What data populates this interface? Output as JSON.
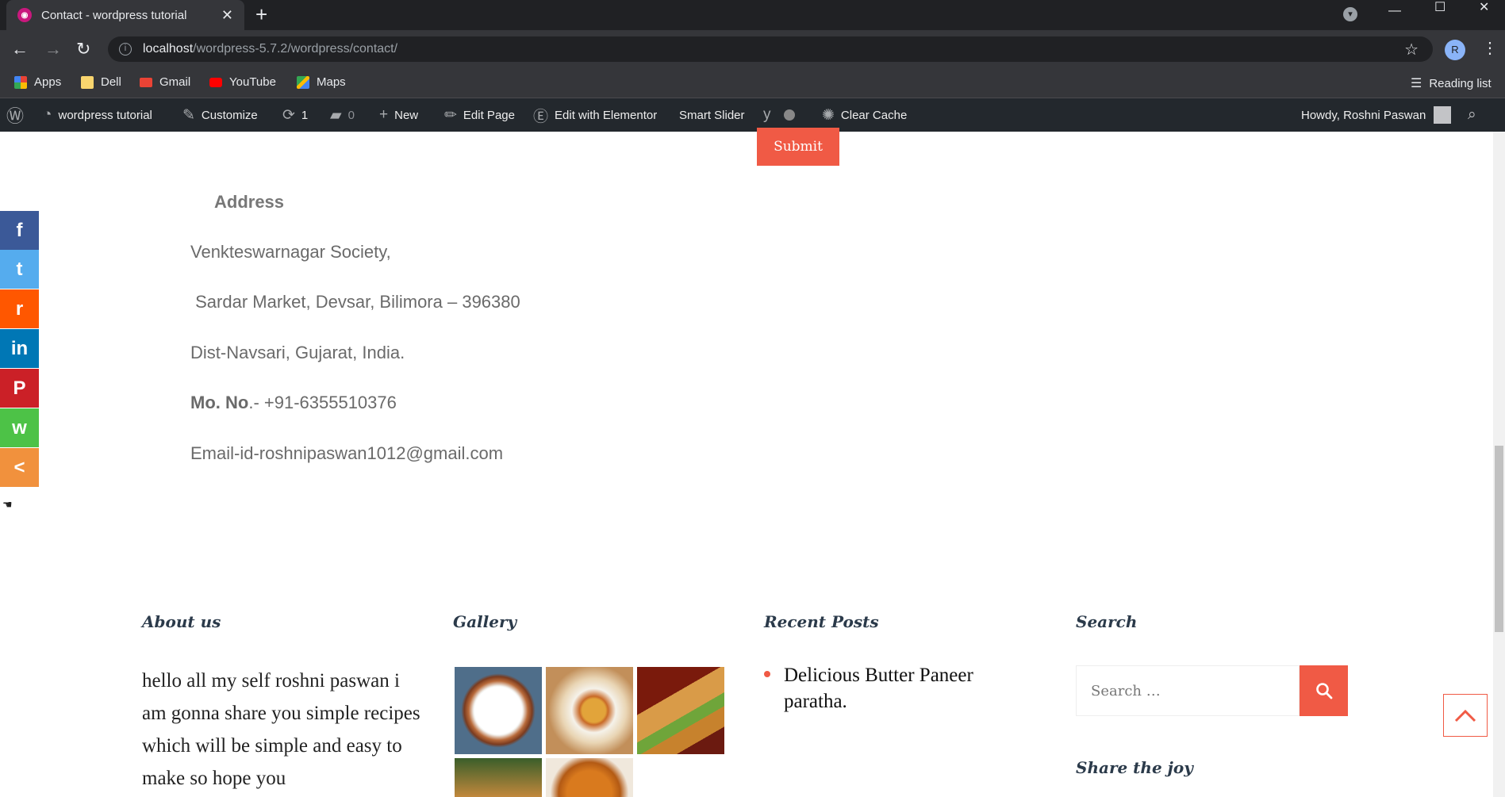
{
  "browser": {
    "tab_title": "Contact - wordpress tutorial",
    "tab_close": "✕",
    "new_tab": "+",
    "url_host": "localhost",
    "url_path": "/wordpress-5.7.2/wordpress/contact/",
    "profile_initial": "R",
    "bookmarks": [
      "Apps",
      "Dell",
      "Gmail",
      "YouTube",
      "Maps"
    ],
    "reading_list": "Reading list"
  },
  "admin_bar": {
    "site_name": "wordpress tutorial",
    "customize": "Customize",
    "updates_count": "1",
    "comments_count": "0",
    "new": "New",
    "edit_page": "Edit Page",
    "edit_elementor": "Edit with Elementor",
    "smart_slider": "Smart Slider",
    "clear_cache": "Clear Cache",
    "howdy": "Howdy, Roshni Paswan"
  },
  "form": {
    "submit_label": "Submit"
  },
  "address": {
    "title": "Address",
    "line1": "Venkteswarnagar Society,",
    "line2": " Sardar Market, Devsar, Bilimora – 396380",
    "line3": "Dist-Navsari, Gujarat, India.",
    "mobile_label": "Mo. No",
    "mobile_value": ".- +91-6355510376",
    "email": "Email-id-roshnipaswan1012@gmail.com"
  },
  "social_share": [
    {
      "name": "facebook",
      "glyph": "f",
      "color": "#3b5998"
    },
    {
      "name": "twitter",
      "glyph": "t",
      "color": "#55acee"
    },
    {
      "name": "reddit",
      "glyph": "r",
      "color": "#ff5700"
    },
    {
      "name": "linkedin",
      "glyph": "in",
      "color": "#0077b5"
    },
    {
      "name": "pinterest",
      "glyph": "P",
      "color": "#cb2027"
    },
    {
      "name": "whatsapp",
      "glyph": "w",
      "color": "#4dc247"
    },
    {
      "name": "share",
      "glyph": "<",
      "color": "#f1913d"
    }
  ],
  "footer": {
    "about_title": "About us",
    "about_text": "hello all my self roshni paswan i am gonna share you simple recipes which will be simple and easy to make so hope you",
    "gallery_title": "Gallery",
    "recent_title": "Recent Posts",
    "recent_posts": [
      "Delicious Butter Paneer paratha."
    ],
    "search_title": "Search",
    "search_placeholder": "Search …",
    "share_title": "Share the joy"
  },
  "colors": {
    "accent": "#f05a45",
    "adminbar": "#23282d",
    "chrome_dark": "#202124",
    "chrome": "#35363a"
  }
}
